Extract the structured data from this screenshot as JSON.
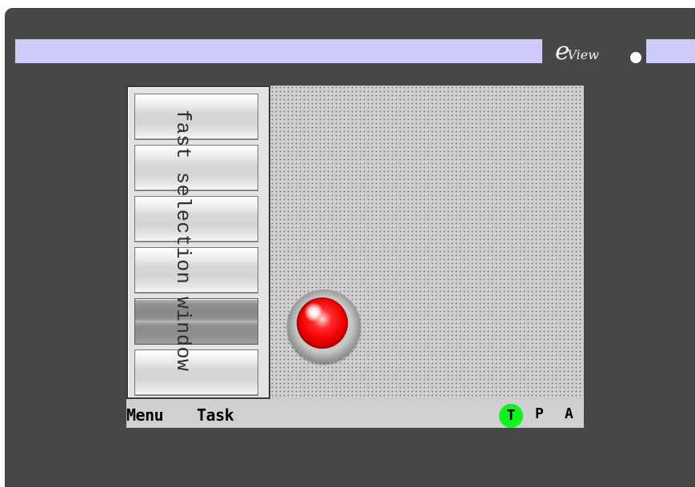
{
  "brand": {
    "logo_letter": "e",
    "logo_text": "View"
  },
  "selection_window": {
    "label": "fast selection window",
    "buttons": [
      {
        "state": "default"
      },
      {
        "state": "default"
      },
      {
        "state": "default"
      },
      {
        "state": "default"
      },
      {
        "state": "active"
      },
      {
        "state": "default"
      }
    ]
  },
  "lamp": {
    "icon": "red-indicator-lamp",
    "color": "#ff0000"
  },
  "bottom_bar": {
    "menu_label": "Menu",
    "task_label": "Task",
    "status_indicators": [
      {
        "label": "T",
        "color": "#11f21f"
      },
      {
        "label": "P"
      },
      {
        "label": "A"
      }
    ]
  },
  "colors": {
    "device": "#474747",
    "title_bar": "#cbcaf8",
    "screen": "#cfcfcf"
  }
}
